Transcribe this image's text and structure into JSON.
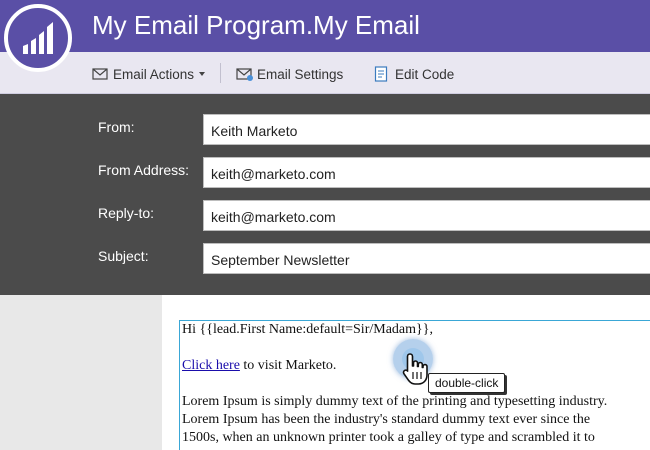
{
  "window": {
    "title": "My Email Program.My Email"
  },
  "brand": {
    "name": "Marketo",
    "accent": "#5a4fa6"
  },
  "toolbar": {
    "email_actions": "Email Actions",
    "email_settings": "Email Settings",
    "edit_code": "Edit Code"
  },
  "fields": [
    {
      "label": "From:",
      "value": "Keith Marketo"
    },
    {
      "label": "From Address:",
      "value": "keith@marketo.com"
    },
    {
      "label": "Reply-to:",
      "value": "keith@marketo.com"
    },
    {
      "label": "Subject:",
      "value": "September Newsletter"
    }
  ],
  "body": {
    "greeting": "Hi {{lead.First Name:default=Sir/Madam}},",
    "link_text": "Click here",
    "link_suffix": " to visit Marketo.",
    "lorem_lines": [
      "Lorem Ipsum is simply dummy text of the printing and typesetting industry.",
      "Lorem Ipsum has been the industry's standard dummy text ever since the",
      "1500s, when an unknown printer took a galley of type and scrambled it to"
    ]
  },
  "hint": {
    "tooltip": "double-click"
  }
}
